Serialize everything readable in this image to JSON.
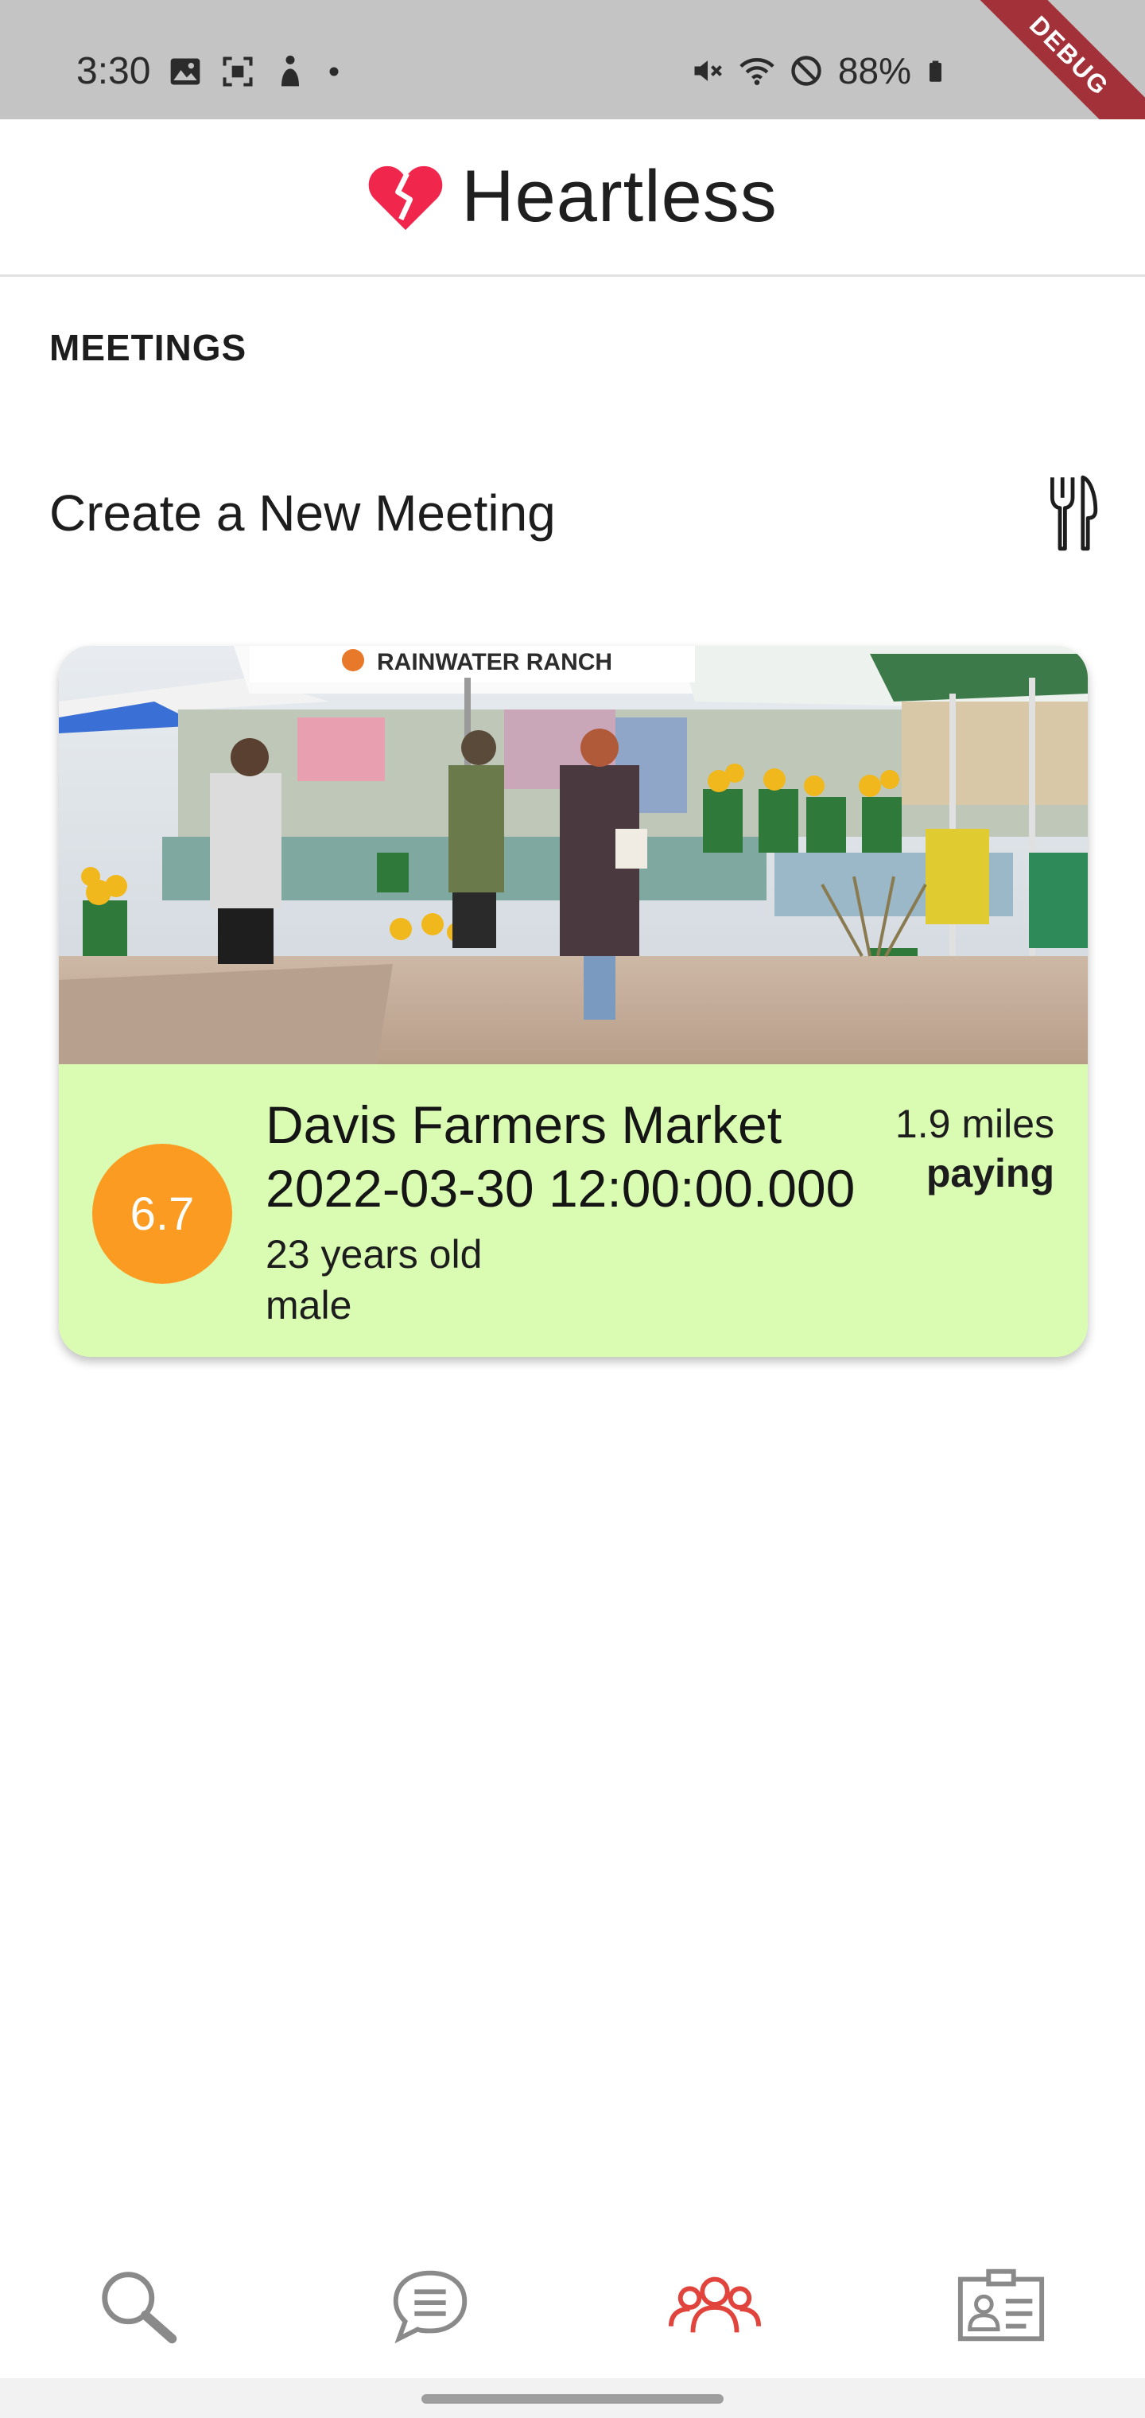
{
  "status_bar": {
    "time": "3:30",
    "battery": "88%",
    "icons_left": [
      "image-icon",
      "screenshot-icon",
      "accessibility-icon",
      "dot-icon"
    ],
    "icons_right": [
      "mute-icon",
      "wifi-icon",
      "do-not-disturb-icon",
      "battery-icon"
    ]
  },
  "debug_banner": "DEBUG",
  "app_bar": {
    "title": "Heartless",
    "logo_icon": "broken-heart-icon",
    "logo_color": "#f0264c"
  },
  "section": {
    "label": "MEETINGS"
  },
  "create": {
    "label": "Create a New Meeting",
    "icon": "utensils-icon"
  },
  "meetings": [
    {
      "score": "6.7",
      "name": "Davis Farmers Market",
      "datetime": "2022-03-30 12:00:00.000",
      "age": "23 years old",
      "gender": "male",
      "distance": "1.9 miles",
      "payment": "paying",
      "card_color": "#d9fcb2",
      "score_color": "#fb9b22",
      "image": "farmers-market-photo",
      "image_banner_text": "RAINWATER RANCH"
    }
  ],
  "bottom_nav": {
    "items": [
      {
        "icon": "search-icon",
        "active": false
      },
      {
        "icon": "chat-icon",
        "active": false
      },
      {
        "icon": "group-icon",
        "active": true
      },
      {
        "icon": "profile-card-icon",
        "active": false
      }
    ],
    "active_color": "#e0443c",
    "inactive_color": "#8a8a8a"
  }
}
